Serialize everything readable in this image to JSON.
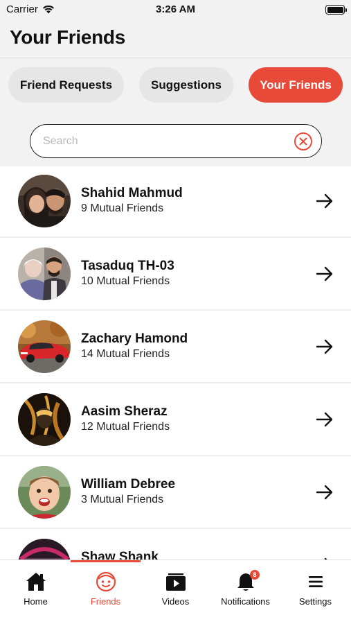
{
  "status_bar": {
    "carrier": "Carrier",
    "time": "3:26 AM"
  },
  "header": {
    "title": "Your Friends"
  },
  "tabs": [
    {
      "label": "Friend Requests",
      "active": false
    },
    {
      "label": "Suggestions",
      "active": false
    },
    {
      "label": "Your Friends",
      "active": true
    }
  ],
  "search": {
    "placeholder": "Search",
    "value": ""
  },
  "friends": [
    {
      "name": "Shahid Mahmud",
      "mutual": "9 Mutual Friends"
    },
    {
      "name": "Tasaduq TH-03",
      "mutual": "10 Mutual Friends"
    },
    {
      "name": "Zachary Hamond",
      "mutual": "14 Mutual Friends"
    },
    {
      "name": "Aasim Sheraz",
      "mutual": "12 Mutual Friends"
    },
    {
      "name": "William Debree",
      "mutual": "3 Mutual Friends"
    },
    {
      "name": "Shaw Shank",
      "mutual": ""
    }
  ],
  "tabbar": {
    "items": [
      {
        "label": "Home",
        "icon": "home-icon",
        "active": false
      },
      {
        "label": "Friends",
        "icon": "friends-icon",
        "active": true
      },
      {
        "label": "Videos",
        "icon": "videos-icon",
        "active": false
      },
      {
        "label": "Notifications",
        "icon": "bell-icon",
        "active": false,
        "badge": "8"
      },
      {
        "label": "Settings",
        "icon": "menu-icon",
        "active": false
      }
    ]
  },
  "colors": {
    "accent": "#e84a39",
    "background": "#f2f2f2",
    "tab_inactive": "#e6e6e6",
    "text": "#111111"
  }
}
